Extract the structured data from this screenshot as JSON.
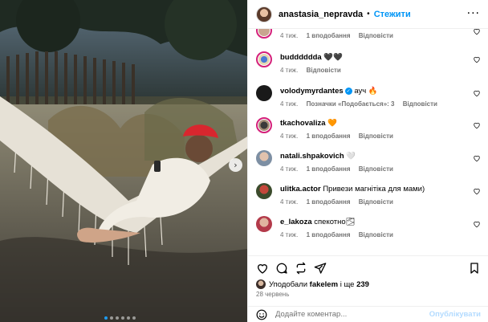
{
  "post": {
    "author": "anastasia_nepravda",
    "follow_label": "Стежити",
    "separator": "•",
    "more_label": "···",
    "carousel_next": "›",
    "colors": {
      "accent": "#0095f6",
      "verified": "#0095f6",
      "story_ring": "#d4207a"
    }
  },
  "comments": [
    {
      "username": "",
      "text": "",
      "partial_top": "····  ·  ·   ·  ·",
      "time": "4 тиж.",
      "likes": "1 вподобання",
      "reply": "Відповісти"
    },
    {
      "username": "buddddddа",
      "text": "🖤🖤",
      "time": "4 тиж.",
      "likes": "",
      "reply": "Відповісти"
    },
    {
      "username": "volodymyrdantes",
      "verified": "✓",
      "text": "ауч 🔥",
      "time": "4 тиж.",
      "likes": "Позначки «Подобається»: 3",
      "reply": "Відповісти"
    },
    {
      "username": "tkachovaliza",
      "text": "🧡",
      "time": "4 тиж.",
      "likes": "1 вподобання",
      "reply": "Відповісти"
    },
    {
      "username": "natali.shpakovich",
      "text": "🤍",
      "time": "4 тиж.",
      "likes": "1 вподобання",
      "reply": "Відповісти"
    },
    {
      "username": "ulitka.actor",
      "text": "Привези магнітіка для мами)",
      "time": "4 тиж.",
      "likes": "1 вподобання",
      "reply": "Відповісти"
    },
    {
      "username": "e_lakoza",
      "text": "спекотно🌫",
      "time": "4 тиж.",
      "likes": "1 вподобання",
      "reply": "Відповісти"
    }
  ],
  "likes_line": {
    "prefix": "Уподобали",
    "user": "fakelem",
    "middle": "і ще",
    "count": "239"
  },
  "date": "28 червень",
  "add_comment": {
    "placeholder": "Додайте коментар...",
    "post_label": "Опублікувати"
  },
  "icons": [
    "heart-icon",
    "comment-icon",
    "repost-icon",
    "share-icon",
    "bookmark-icon",
    "emoji-icon",
    "verified-icon"
  ]
}
